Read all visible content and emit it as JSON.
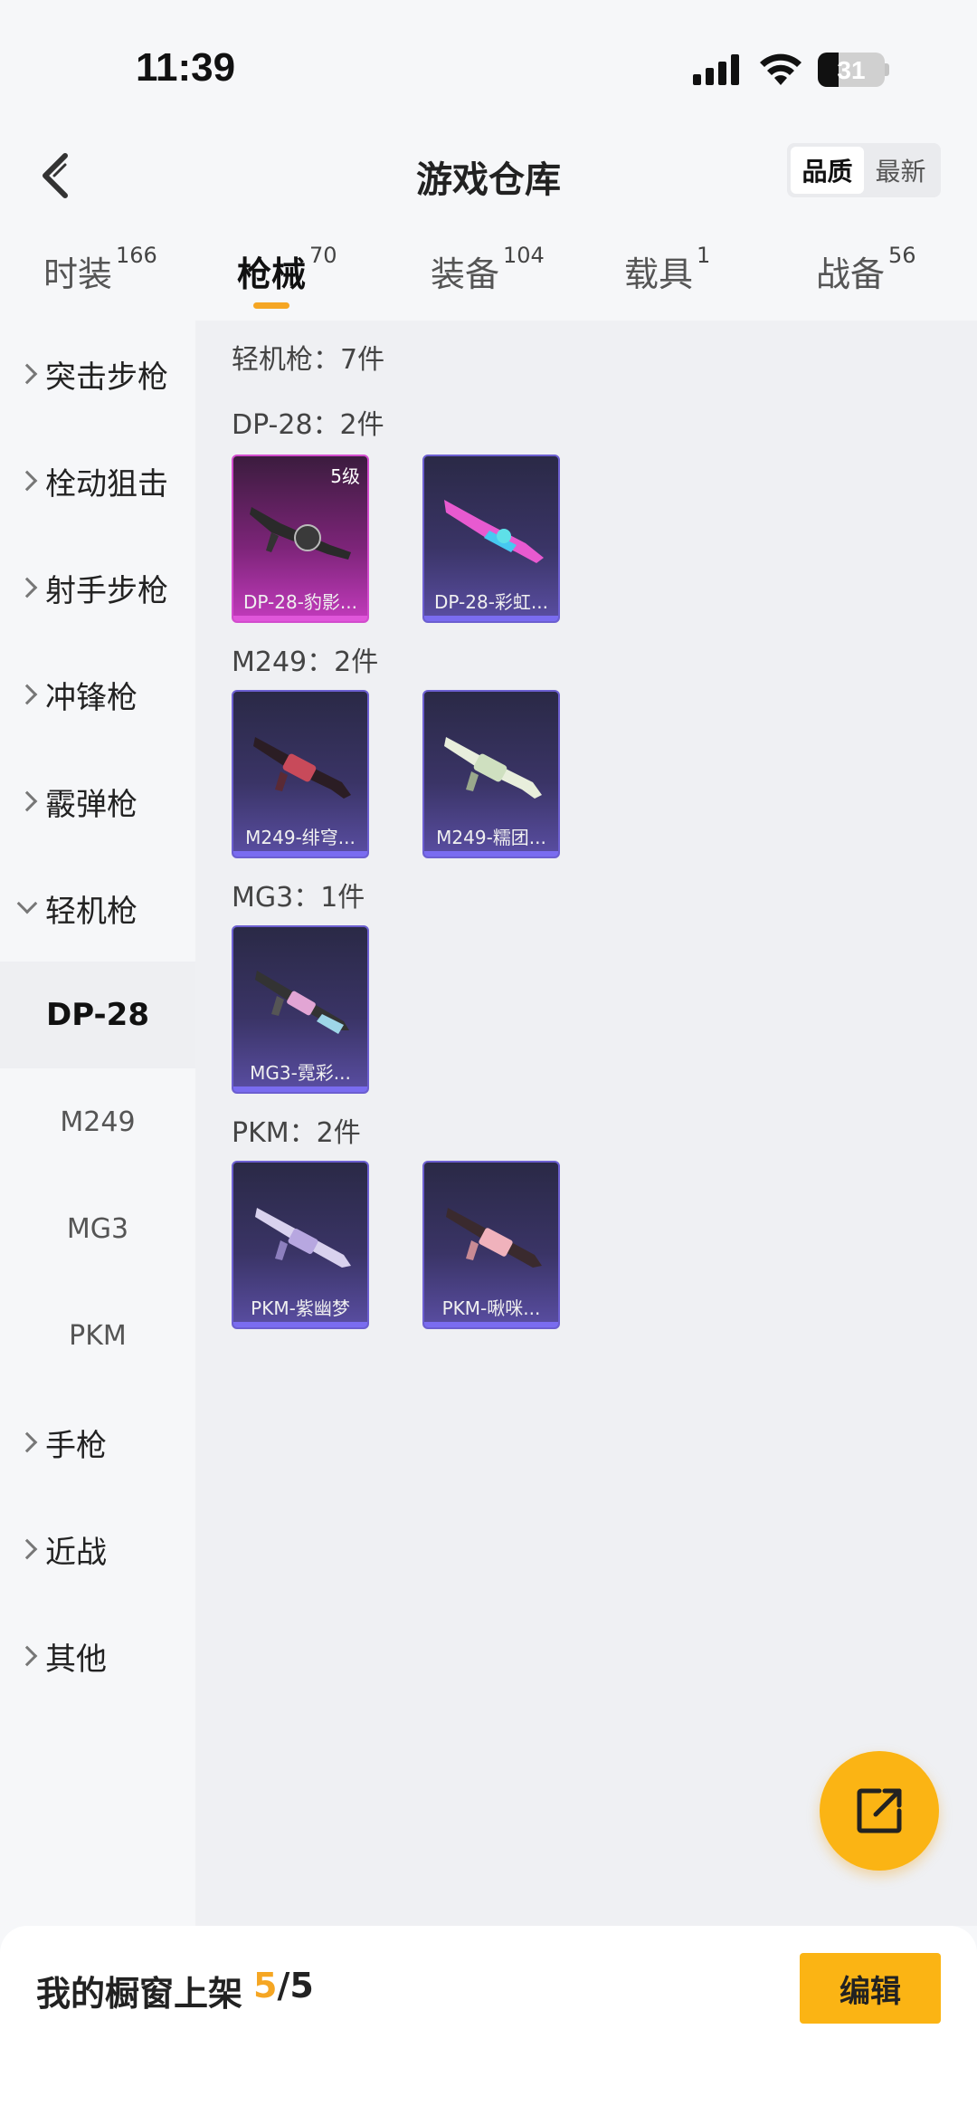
{
  "status_bar": {
    "time": "11:39",
    "battery": "31",
    "battery_fraction": 0.31
  },
  "header": {
    "title": "游戏仓库",
    "sort_options": [
      "品质",
      "最新"
    ],
    "active_sort": "品质"
  },
  "tabs": [
    {
      "label": "时装",
      "count": "166"
    },
    {
      "label": "枪械",
      "count": "70"
    },
    {
      "label": "装备",
      "count": "104"
    },
    {
      "label": "载具",
      "count": "1"
    },
    {
      "label": "战备",
      "count": "56"
    }
  ],
  "active_tab": "枪械",
  "sidebar": {
    "categories": [
      "突击步枪",
      "栓动狙击",
      "射手步枪",
      "冲锋枪",
      "霰弹枪",
      "轻机枪",
      "手枪",
      "近战",
      "其他"
    ],
    "expanded": "轻机枪",
    "subitems": [
      "DP-28",
      "M249",
      "MG3",
      "PKM"
    ],
    "active_sub": "DP-28"
  },
  "main": {
    "category_header": "轻机枪：7件",
    "groups": [
      {
        "title": "DP-28：2件",
        "items": [
          {
            "name": "DP-28-豹影...",
            "level": "5级",
            "rarity": "pink"
          },
          {
            "name": "DP-28-彩虹...",
            "level": "",
            "rarity": "purple"
          }
        ]
      },
      {
        "title": "M249：2件",
        "items": [
          {
            "name": "M249-绯穹...",
            "level": "",
            "rarity": "purple"
          },
          {
            "name": "M249-糯团...",
            "level": "",
            "rarity": "purple"
          }
        ]
      },
      {
        "title": "MG3：1件",
        "items": [
          {
            "name": "MG3-霓彩...",
            "level": "",
            "rarity": "purple"
          }
        ]
      },
      {
        "title": "PKM：2件",
        "items": [
          {
            "name": "PKM-紫幽梦",
            "level": "",
            "rarity": "purple"
          },
          {
            "name": "PKM-啾咪...",
            "level": "",
            "rarity": "purple"
          }
        ]
      }
    ]
  },
  "bottom_bar": {
    "label": "我的橱窗上架",
    "count_current": "5",
    "count_sep_total": "/5",
    "edit_label": "编辑"
  },
  "colors": {
    "accent": "#fbb414",
    "highlight": "#f5a623",
    "purple_rarity": "#6c5fd0",
    "pink_rarity": "#d24ccd"
  }
}
